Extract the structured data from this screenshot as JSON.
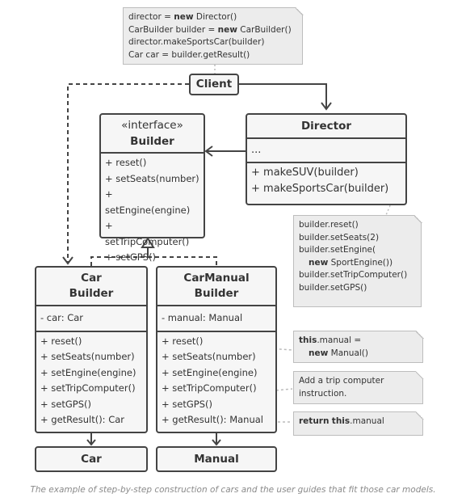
{
  "notes": {
    "client_note": [
      {
        "parts": [
          {
            "t": "director = "
          },
          {
            "t": "new",
            "b": true
          },
          {
            "t": " Director()"
          }
        ]
      },
      {
        "parts": [
          {
            "t": "CarBuilder builder = "
          },
          {
            "t": "new",
            "b": true
          },
          {
            "t": " CarBuilder()"
          }
        ]
      },
      {
        "parts": [
          {
            "t": "director.makeSportsCar(builder)"
          }
        ]
      },
      {
        "parts": [
          {
            "t": "Car car = builder.getResult()"
          }
        ]
      }
    ],
    "director_note": [
      {
        "parts": [
          {
            "t": "builder.reset()"
          }
        ]
      },
      {
        "parts": [
          {
            "t": "builder.setSeats(2)"
          }
        ]
      },
      {
        "parts": [
          {
            "t": "builder.setEngine("
          }
        ]
      },
      {
        "indent": true,
        "parts": [
          {
            "t": "new",
            "b": true
          },
          {
            "t": " SportEngine())"
          }
        ]
      },
      {
        "parts": [
          {
            "t": "builder.setTripComputer()"
          }
        ]
      },
      {
        "parts": [
          {
            "t": "builder.setGPS()"
          }
        ]
      }
    ],
    "reset_note": [
      {
        "parts": [
          {
            "t": "this",
            "b": true
          },
          {
            "t": ".manual ="
          }
        ]
      },
      {
        "indent": true,
        "parts": [
          {
            "t": "new",
            "b": true
          },
          {
            "t": " Manual()"
          }
        ]
      }
    ],
    "trip_note": [
      {
        "parts": [
          {
            "t": "Add a trip computer"
          }
        ]
      },
      {
        "parts": [
          {
            "t": "instruction."
          }
        ]
      }
    ],
    "result_note": [
      {
        "parts": [
          {
            "t": "return",
            "b": true
          },
          {
            "t": " "
          },
          {
            "t": "this",
            "b": true
          },
          {
            "t": ".manual"
          }
        ]
      }
    ]
  },
  "client": {
    "label": "Client"
  },
  "builder": {
    "stereotype": "«interface»",
    "name": "Builder",
    "methods": [
      "+ reset()",
      "+ setSeats(number)",
      "+ setEngine(engine)",
      "+ setTripComputer()",
      "+ setGPS()"
    ]
  },
  "director": {
    "name": "Director",
    "fields": [
      "..."
    ],
    "methods": [
      "+ makeSUV(builder)",
      "+ makeSportsCar(builder)"
    ]
  },
  "car_builder": {
    "name_line1": "Car",
    "name_line2": "Builder",
    "fields": [
      "- car: Car"
    ],
    "methods": [
      "+ reset()",
      "+ setSeats(number)",
      "+ setEngine(engine)",
      "+ setTripComputer()",
      "+ setGPS()",
      "+ getResult(): Car"
    ]
  },
  "manual_builder": {
    "name_line1": "CarManual",
    "name_line2": "Builder",
    "fields": [
      "- manual: Manual"
    ],
    "methods": [
      "+ reset()",
      "+ setSeats(number)",
      "+ setEngine(engine)",
      "+ setTripComputer()",
      "+ setGPS()",
      "+ getResult(): Manual"
    ]
  },
  "car": {
    "label": "Car"
  },
  "manual": {
    "label": "Manual"
  },
  "caption": "The example of step-by-step construction of cars and the user guides that fit those car models."
}
